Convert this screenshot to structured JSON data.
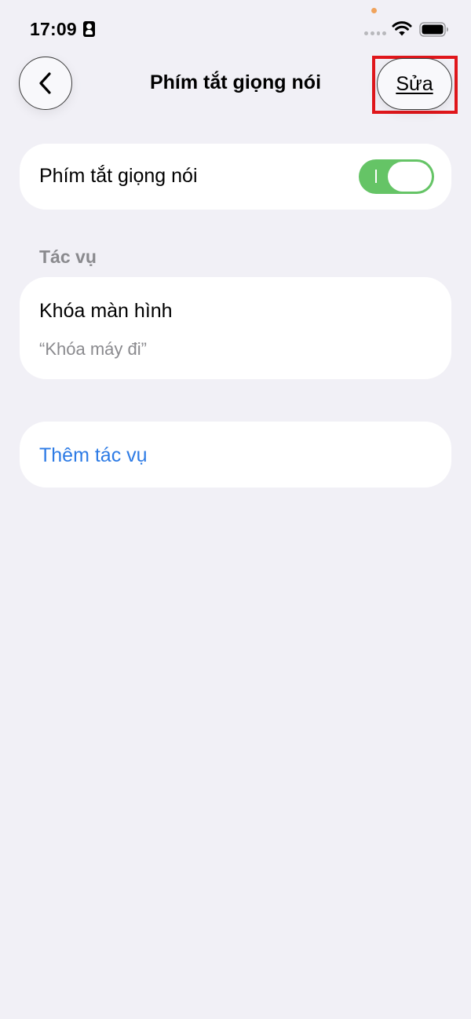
{
  "status_bar": {
    "time": "17:09"
  },
  "nav": {
    "title": "Phím tắt giọng nói",
    "edit_label": "Sửa"
  },
  "toggle_row": {
    "label": "Phím tắt giọng nói",
    "enabled": true
  },
  "actions_section": {
    "header": "Tác vụ",
    "items": [
      {
        "title": "Khóa màn hình",
        "phrase": "“Khóa máy đi”"
      }
    ]
  },
  "add_action": {
    "label": "Thêm tác vụ"
  },
  "colors": {
    "background": "#f1f0f6",
    "toggle_on": "#65c466",
    "link": "#2d7be5",
    "highlight": "#e0161b"
  }
}
